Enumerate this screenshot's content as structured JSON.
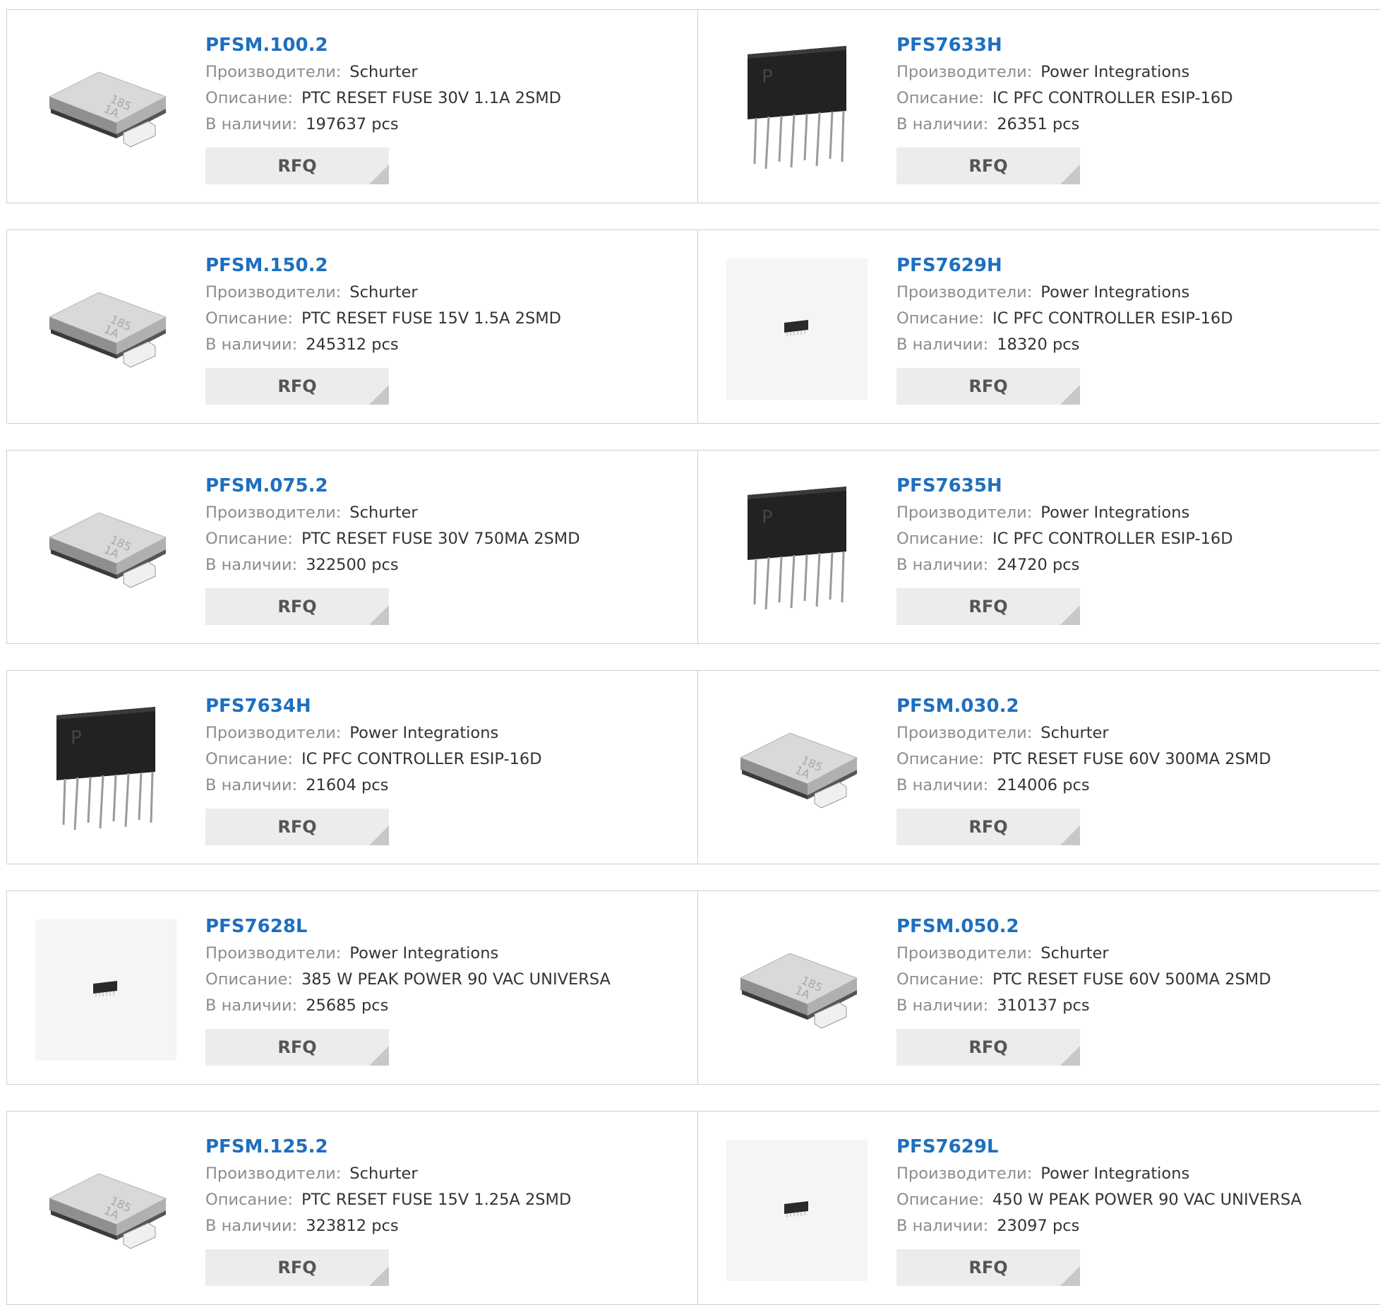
{
  "labels": {
    "manufacturer": "Производители:",
    "description": "Описание:",
    "stock": "В наличии:",
    "rfq": "RFQ"
  },
  "colors": {
    "link": "#1e6fbf",
    "label": "#8c8c8c",
    "value": "#333333",
    "button_bg": "#ececec",
    "border": "#cfcfcf"
  },
  "products": [
    {
      "name": "PFSM.100.2",
      "manufacturer": "Schurter",
      "description": "PTC RESET FUSE 30V 1.1A 2SMD",
      "stock": "197637 pcs",
      "image": "smd-fuse-image"
    },
    {
      "name": "PFS7633H",
      "manufacturer": "Power Integrations",
      "description": "IC PFC CONTROLLER ESIP-16D",
      "stock": "26351 pcs",
      "image": "esip-chip-image"
    },
    {
      "name": "PFSM.150.2",
      "manufacturer": "Schurter",
      "description": "PTC RESET FUSE 15V 1.5A 2SMD",
      "stock": "245312 pcs",
      "image": "smd-fuse-image"
    },
    {
      "name": "PFS7629H",
      "manufacturer": "Power Integrations",
      "description": "IC PFC CONTROLLER ESIP-16D",
      "stock": "18320 pcs",
      "image": "small-chip-image"
    },
    {
      "name": "PFSM.075.2",
      "manufacturer": "Schurter",
      "description": "PTC RESET FUSE 30V 750MA 2SMD",
      "stock": "322500 pcs",
      "image": "smd-fuse-image"
    },
    {
      "name": "PFS7635H",
      "manufacturer": "Power Integrations",
      "description": "IC PFC CONTROLLER ESIP-16D",
      "stock": "24720 pcs",
      "image": "esip-chip-image"
    },
    {
      "name": "PFS7634H",
      "manufacturer": "Power Integrations",
      "description": "IC PFC CONTROLLER ESIP-16D",
      "stock": "21604 pcs",
      "image": "esip-chip-image"
    },
    {
      "name": "PFSM.030.2",
      "manufacturer": "Schurter",
      "description": "PTC RESET FUSE 60V 300MA 2SMD",
      "stock": "214006 pcs",
      "image": "smd-fuse-image"
    },
    {
      "name": "PFS7628L",
      "manufacturer": "Power Integrations",
      "description": "385 W PEAK POWER 90 VAC UNIVERSA",
      "stock": "25685 pcs",
      "image": "small-chip-image"
    },
    {
      "name": "PFSM.050.2",
      "manufacturer": "Schurter",
      "description": "PTC RESET FUSE 60V 500MA 2SMD",
      "stock": "310137 pcs",
      "image": "smd-fuse-image"
    },
    {
      "name": "PFSM.125.2",
      "manufacturer": "Schurter",
      "description": "PTC RESET FUSE 15V 1.25A 2SMD",
      "stock": "323812 pcs",
      "image": "smd-fuse-image"
    },
    {
      "name": "PFS7629L",
      "manufacturer": "Power Integrations",
      "description": "450 W PEAK POWER 90 VAC UNIVERSA",
      "stock": "23097 pcs",
      "image": "small-chip-image"
    }
  ]
}
